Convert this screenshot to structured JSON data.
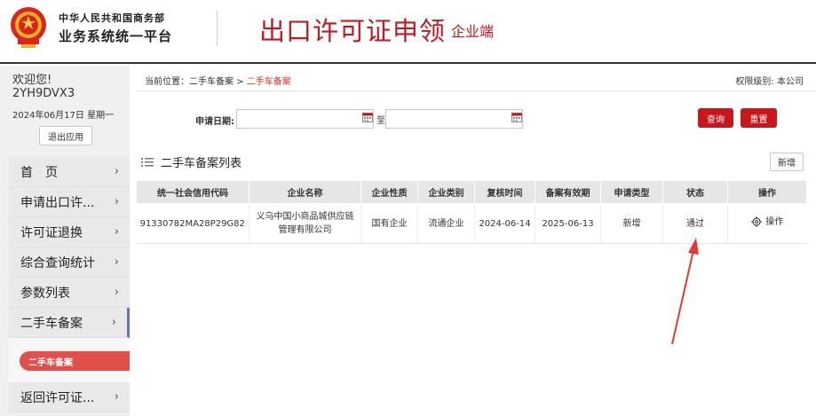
{
  "header": {
    "brand_top": "中华人民共和国商务部",
    "brand_bottom": "业务系统统一平台",
    "app_title": "出口许可证申领",
    "app_subtitle": "企业端"
  },
  "sidebar": {
    "welcome": "欢迎您!",
    "user_id": "2YH9DVX3",
    "date": "2024年06月17日 星期一",
    "logout_label": "退出应用",
    "items": [
      {
        "label": "首　页"
      },
      {
        "label": "申请出口许..."
      },
      {
        "label": "许可证退换"
      },
      {
        "label": "综合查询统计"
      },
      {
        "label": "参数列表"
      },
      {
        "label": "二手车备案"
      },
      {
        "label": "返回许可证..."
      }
    ],
    "submenu_label": "二手车备案"
  },
  "breadcrumb": {
    "prefix": "当前位置：",
    "path": "二手车备案 > ",
    "current": "二手车备案"
  },
  "permission": "权限级别: 本公司",
  "filter": {
    "date_label": "申请日期:",
    "to_label": "至",
    "start_value": "",
    "end_value": "",
    "search_label": "查询",
    "reset_label": "重置"
  },
  "list": {
    "title": "二手车备案列表",
    "add_label": "新增",
    "columns": [
      "统一社会信用代码",
      "企业名称",
      "企业性质",
      "企业类别",
      "复核时间",
      "备案有效期",
      "申请类型",
      "状态",
      "操作"
    ],
    "rows": [
      {
        "credit_code": "91330782MA28P29G82",
        "company": "义乌中国小商品城供应链管理有限公司",
        "nature": "国有企业",
        "category": "流通企业",
        "review_time": "2024-06-14",
        "valid_until": "2025-06-13",
        "apply_type": "新增",
        "status": "通过",
        "action": "操作"
      }
    ]
  },
  "colors": {
    "brand_red": "#c6161e",
    "button_red": "#c8161d",
    "arrow_red": "#e53935",
    "submenu_red": "#e2504c"
  }
}
